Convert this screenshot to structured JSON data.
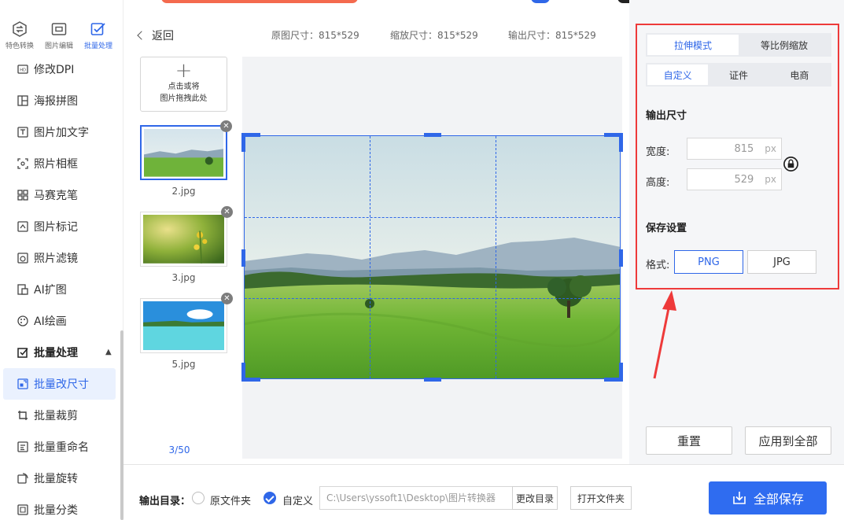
{
  "colors": {
    "accent": "#2f67e8",
    "highlight_box": "#ee3a3a",
    "save_button": "#2f6cf0"
  },
  "top_nav": [
    {
      "label": "特色转换",
      "icon": "convert-icon"
    },
    {
      "label": "图片编辑",
      "icon": "image-edit-icon"
    },
    {
      "label": "批量处理",
      "icon": "batch-icon",
      "active": true
    }
  ],
  "sidebar": {
    "items": [
      {
        "label": "修改DPI",
        "icon": "dpi-icon"
      },
      {
        "label": "海报拼图",
        "icon": "collage-icon"
      },
      {
        "label": "图片加文字",
        "icon": "add-text-icon"
      },
      {
        "label": "照片相框",
        "icon": "frame-icon"
      },
      {
        "label": "马赛克笔",
        "icon": "mosaic-icon"
      },
      {
        "label": "图片标记",
        "icon": "mark-icon"
      },
      {
        "label": "照片滤镜",
        "icon": "filter-icon"
      },
      {
        "label": "AI扩图",
        "icon": "ai-expand-icon"
      },
      {
        "label": "AI绘画",
        "icon": "ai-paint-icon"
      }
    ],
    "group": {
      "label": "批量处理",
      "icon": "batch-check-icon",
      "expanded": true
    },
    "sub_items": [
      {
        "label": "批量改尺寸",
        "icon": "resize-icon",
        "active": true
      },
      {
        "label": "批量裁剪",
        "icon": "crop-icon"
      },
      {
        "label": "批量重命名",
        "icon": "rename-icon"
      },
      {
        "label": "批量旋转",
        "icon": "rotate-icon"
      },
      {
        "label": "批量分类",
        "icon": "classify-icon"
      }
    ]
  },
  "header": {
    "back": "返回",
    "original_size": "原图尺寸：815*529",
    "scaled_size": "缩放尺寸：815*529",
    "output_size": "输出尺寸：815*529"
  },
  "add_image": {
    "line1": "点击或将",
    "line2": "图片拖拽此处"
  },
  "thumbnails": [
    {
      "name": "2.jpg",
      "selected": true
    },
    {
      "name": "3.jpg"
    },
    {
      "name": "5.jpg"
    }
  ],
  "counter": "3/50",
  "settings": {
    "mode_tabs": [
      "拉伸模式",
      "等比例缩放"
    ],
    "mode_active": 0,
    "preset_tabs": [
      "自定义",
      "证件",
      "电商"
    ],
    "preset_active": 0,
    "output_size_title": "输出尺寸",
    "width_label": "宽度:",
    "width_value": "815",
    "height_label": "高度:",
    "height_value": "529",
    "unit": "px",
    "save_title": "保存设置",
    "format_label": "格式:",
    "formats": [
      "PNG",
      "JPG"
    ],
    "format_active": 0,
    "reset": "重置",
    "apply_all": "应用到全部"
  },
  "bottom": {
    "output_dir_label": "输出目录：",
    "radio_original": "原文件夹",
    "radio_custom": "自定义",
    "path": "C:\\Users\\yssoft1\\Desktop\\图片转换器",
    "change_dir": "更改目录",
    "open_folder": "打开文件夹",
    "save_all": "全部保存"
  }
}
